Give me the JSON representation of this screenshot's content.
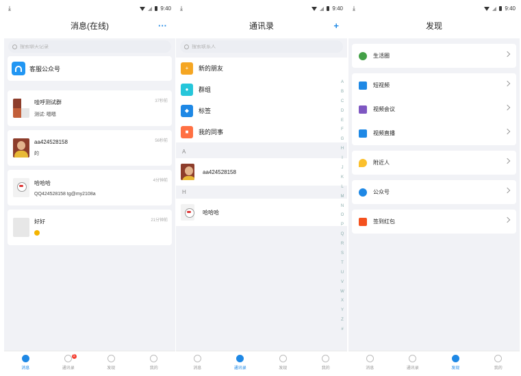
{
  "status": {
    "time": "9:40"
  },
  "messages": {
    "title": "消息(在线)",
    "more_icon": "···",
    "search_placeholder": "搜索聊天记录",
    "service": {
      "label": "客服公众号"
    },
    "conversations": [
      {
        "name": "哇呼测试群",
        "msg": "测试: 嗯嗯",
        "time": "37秒前"
      },
      {
        "name": "aa424528158",
        "msg": "的",
        "time": "56秒前"
      },
      {
        "name": "哈哈哈",
        "msg": "QQ424528158 tg@my2108a",
        "time": "4分钟前"
      },
      {
        "name": "好好",
        "msg": "",
        "time": "21分钟前"
      }
    ]
  },
  "contacts": {
    "title": "通讯录",
    "add_icon": "+",
    "search_placeholder": "搜索联系人",
    "functions": [
      {
        "label": "新的朋友",
        "color": "#f5a623"
      },
      {
        "label": "群组",
        "color": "#26c6da"
      },
      {
        "label": "标签",
        "color": "#1e88e5"
      },
      {
        "label": "我的同事",
        "color": "#ff7043"
      }
    ],
    "sections": [
      {
        "letter": "A",
        "name": "aa424528158"
      },
      {
        "letter": "H",
        "name": "哈哈哈"
      }
    ],
    "index": [
      "A",
      "B",
      "C",
      "D",
      "E",
      "F",
      "G",
      "H",
      "I",
      "J",
      "K",
      "L",
      "M",
      "N",
      "O",
      "P",
      "Q",
      "R",
      "S",
      "T",
      "U",
      "V",
      "W",
      "X",
      "Y",
      "Z",
      "#"
    ]
  },
  "discover": {
    "title": "发现",
    "groups": [
      [
        {
          "label": "生活圈",
          "icon": "pinwheel-icon",
          "color": "#43a047"
        }
      ],
      [
        {
          "label": "短视频",
          "icon": "play-icon",
          "color": "#1e88e5"
        },
        {
          "label": "视频会议",
          "icon": "meeting-icon",
          "color": "#7e57c2"
        },
        {
          "label": "视频直播",
          "icon": "live-icon",
          "color": "#1e88e5"
        }
      ],
      [
        {
          "label": "附近人",
          "icon": "location-icon",
          "color": "#fbc02d"
        }
      ],
      [
        {
          "label": "公众号",
          "icon": "official-account-icon",
          "color": "#1e88e5"
        }
      ],
      [
        {
          "label": "签到红包",
          "icon": "red-packet-icon",
          "color": "#f4511e"
        }
      ]
    ]
  },
  "nav": {
    "items": [
      "消息",
      "通讯录",
      "发现",
      "我的"
    ],
    "badge": "1"
  }
}
